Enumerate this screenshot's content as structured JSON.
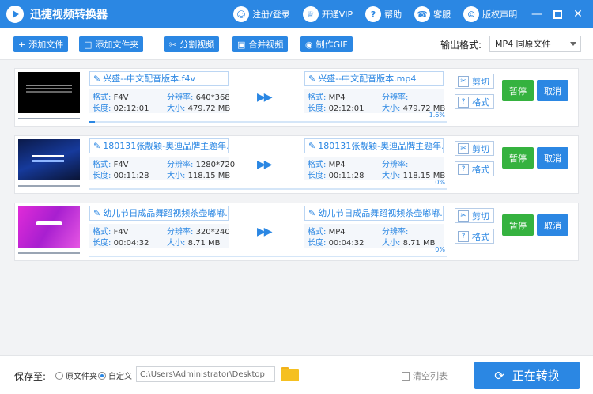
{
  "app": {
    "title": "迅捷视频转换器"
  },
  "top_links": [
    {
      "label": "注册/登录",
      "icon": "user-icon"
    },
    {
      "label": "开通VIP",
      "icon": "crown-icon"
    },
    {
      "label": "帮助",
      "icon": "help-icon"
    },
    {
      "label": "客服",
      "icon": "headset-icon"
    },
    {
      "label": "版权声明",
      "icon": "copyright-icon"
    }
  ],
  "toolbar": {
    "add_file": "添加文件",
    "add_folder": "添加文件夹",
    "split_video": "分割视频",
    "merge_video": "合并视频",
    "make_gif": "制作GIF",
    "output_format_label": "输出格式:",
    "output_format_value": "MP4  同原文件"
  },
  "labels": {
    "format": "格式:",
    "resolution": "分辨率:",
    "duration": "长度:",
    "size": "大小:",
    "cut": "剪切",
    "fmt": "格式",
    "pause": "暂停",
    "cancel": "取消"
  },
  "tasks": [
    {
      "src_name": "兴盛--中文配音版本.f4v",
      "src_format": "F4V",
      "src_resolution": "640*368",
      "src_duration": "02:12:01",
      "src_size": "479.72 MB",
      "dst_name": "兴盛--中文配音版本.mp4",
      "dst_format": "MP4",
      "dst_resolution": "",
      "dst_duration": "02:12:01",
      "dst_size": "479.72 MB",
      "progress_percent": 1.6,
      "progress_label": "1.6%"
    },
    {
      "src_name": "180131张靓颖-奥迪品牌主题年...",
      "src_format": "F4V",
      "src_resolution": "1280*720",
      "src_duration": "00:11:28",
      "src_size": "118.15 MB",
      "dst_name": "180131张靓颖-奥迪品牌主题年...",
      "dst_format": "MP4",
      "dst_resolution": "",
      "dst_duration": "00:11:28",
      "dst_size": "118.15 MB",
      "progress_percent": 0,
      "progress_label": "0%"
    },
    {
      "src_name": "幼儿节日成品舞蹈视频茶壶嘟嘟.",
      "src_format": "F4V",
      "src_resolution": "320*240",
      "src_duration": "00:04:32",
      "src_size": "8.71 MB",
      "dst_name": "幼儿节日成品舞蹈视频茶壶嘟嘟.",
      "dst_format": "MP4",
      "dst_resolution": "",
      "dst_duration": "00:04:32",
      "dst_size": "8.71 MB",
      "progress_percent": 0,
      "progress_label": "0%"
    }
  ],
  "bottom": {
    "save_to_label": "保存至:",
    "radio_original": "原文件夹",
    "radio_custom": "自定义",
    "selected": "自定义",
    "path_value": "C:\\Users\\Administrator\\Desktop",
    "clear_list": "清空列表",
    "start_convert": "正在转换"
  },
  "colors": {
    "accent": "#2b87e3",
    "pause": "#35b23f"
  }
}
